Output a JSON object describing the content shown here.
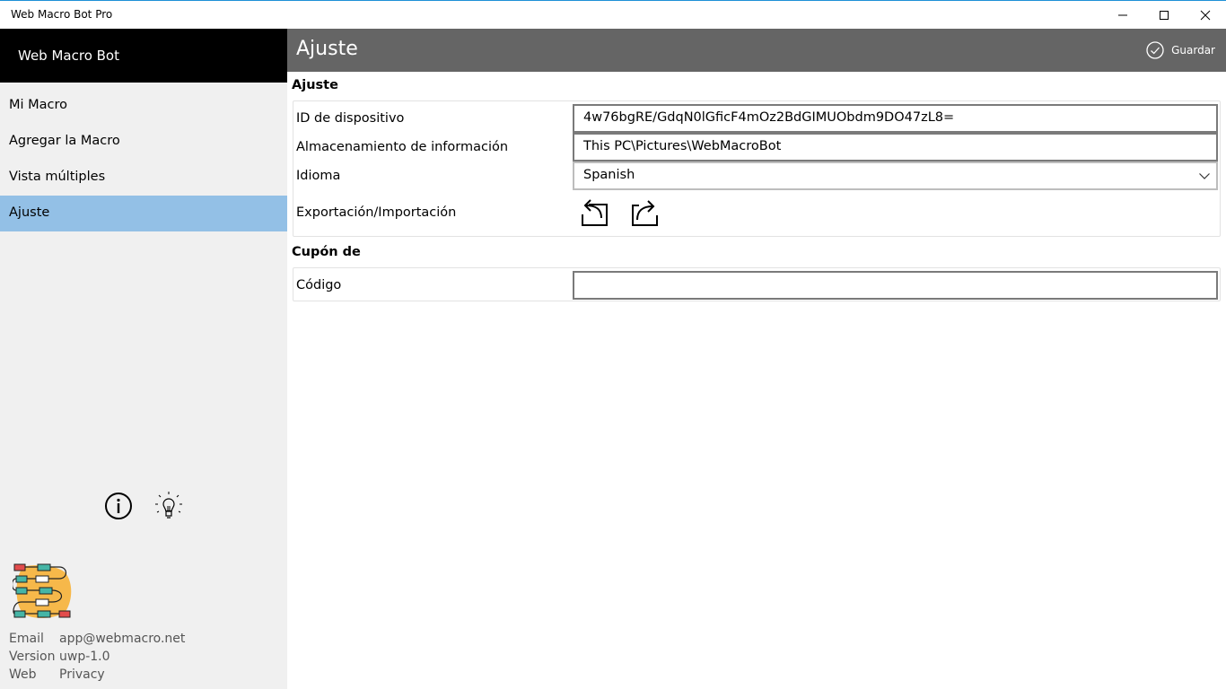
{
  "window": {
    "title": "Web Macro Bot Pro"
  },
  "sidebar": {
    "header": "Web Macro Bot",
    "items": [
      {
        "label": "Mi Macro"
      },
      {
        "label": "Agregar la Macro"
      },
      {
        "label": "Vista múltiples"
      },
      {
        "label": "Ajuste"
      }
    ],
    "active_index": 3,
    "active_color": "#93c0e6",
    "icons": [
      "info-icon",
      "lightbulb-icon"
    ],
    "meta": [
      {
        "key": "Email",
        "value": "app@webmacro.net"
      },
      {
        "key": "Version",
        "value": "uwp-1.0"
      },
      {
        "key": "Web",
        "value": "Privacy"
      }
    ]
  },
  "main": {
    "title": "Ajuste",
    "save_label": "Guardar",
    "settings_section": {
      "title": "Ajuste",
      "device_id_label": "ID de dispositivo",
      "device_id_value": "4w76bgRE/GdqN0lGficF4mOz2BdGIMUObdm9DO47zL8=",
      "storage_label": "Almacenamiento de información",
      "storage_value": "This PC\\Pictures\\WebMacroBot",
      "language_label": "Idioma",
      "language_value": "Spanish",
      "export_import_label": "Exportación/Importación"
    },
    "coupon_section": {
      "title": "Cupón de",
      "code_label": "Código",
      "code_value": ""
    }
  },
  "colors": {
    "header_bg": "#656565",
    "sidebar_header_bg": "#000000",
    "sidebar_bg": "#f0f0f0"
  }
}
